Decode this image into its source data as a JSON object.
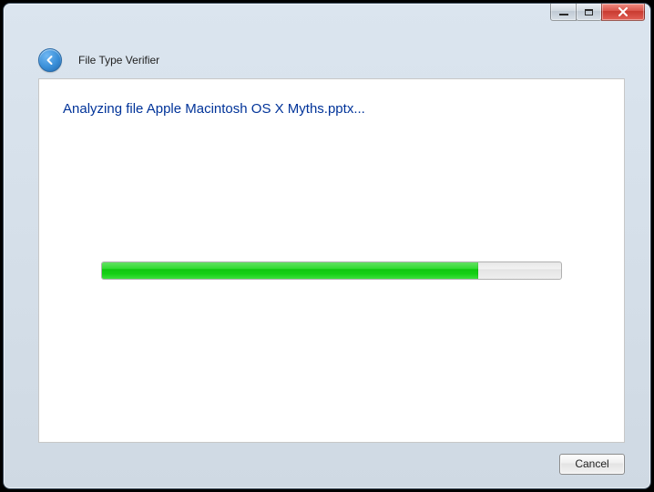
{
  "window": {
    "app_title": "File Type Verifier"
  },
  "main": {
    "status_text": "Analyzing file Apple Macintosh OS X Myths.pptx...",
    "progress_percent": 82
  },
  "footer": {
    "cancel_label": "Cancel"
  },
  "icons": {
    "minimize": "minimize",
    "maximize": "maximize",
    "close": "close",
    "back": "back"
  }
}
